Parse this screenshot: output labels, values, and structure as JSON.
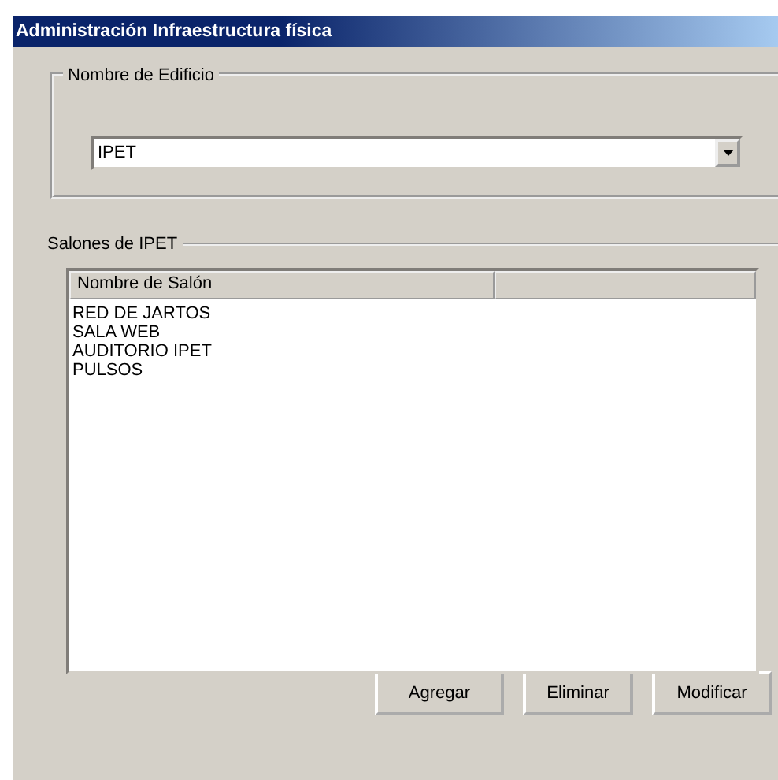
{
  "window": {
    "title": "Administración Infraestructura física"
  },
  "building_group": {
    "label": "Nombre de Edificio",
    "combo": {
      "value": "IPET"
    }
  },
  "rooms_group": {
    "label": "Salones de IPET",
    "list": {
      "columns": [
        "Nombre de Salón"
      ],
      "rows": [
        "RED DE JARTOS",
        "SALA WEB",
        "AUDITORIO IPET",
        "PULSOS"
      ]
    }
  },
  "buttons": [
    "Agregar",
    "Eliminar",
    "Modificar"
  ]
}
